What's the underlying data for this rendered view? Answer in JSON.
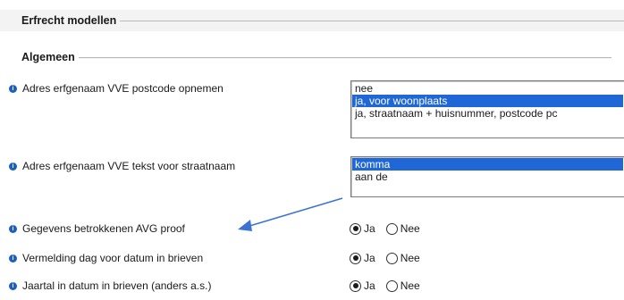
{
  "sections": {
    "main_title": "Erfrecht modellen",
    "general_title": "Algemeen"
  },
  "settings": [
    {
      "label": "Adres erfgenaam VVE postcode opnemen",
      "options": [
        "nee",
        "ja, voor woonplaats",
        "ja, straatnaam + huisnummer, postcode pc"
      ],
      "selected": "ja, voor woonplaats"
    },
    {
      "label": "Adres erfgenaam VVE tekst voor straatnaam",
      "options": [
        "komma",
        "aan de"
      ],
      "selected": "komma"
    },
    {
      "label": "Gegevens betrokkenen AVG proof",
      "yes": "Ja",
      "no": "Nee",
      "value": "Ja"
    },
    {
      "label": "Vermelding dag voor datum in brieven",
      "yes": "Ja",
      "no": "Nee",
      "value": "Ja"
    },
    {
      "label": "Jaartal in datum in brieven (anders a.s.)",
      "yes": "Ja",
      "no": "Nee",
      "value": "Ja"
    }
  ],
  "colors": {
    "selection": "#1f67d6",
    "info_icon": "#1c5fbf",
    "arrow": "#3b73d1"
  }
}
